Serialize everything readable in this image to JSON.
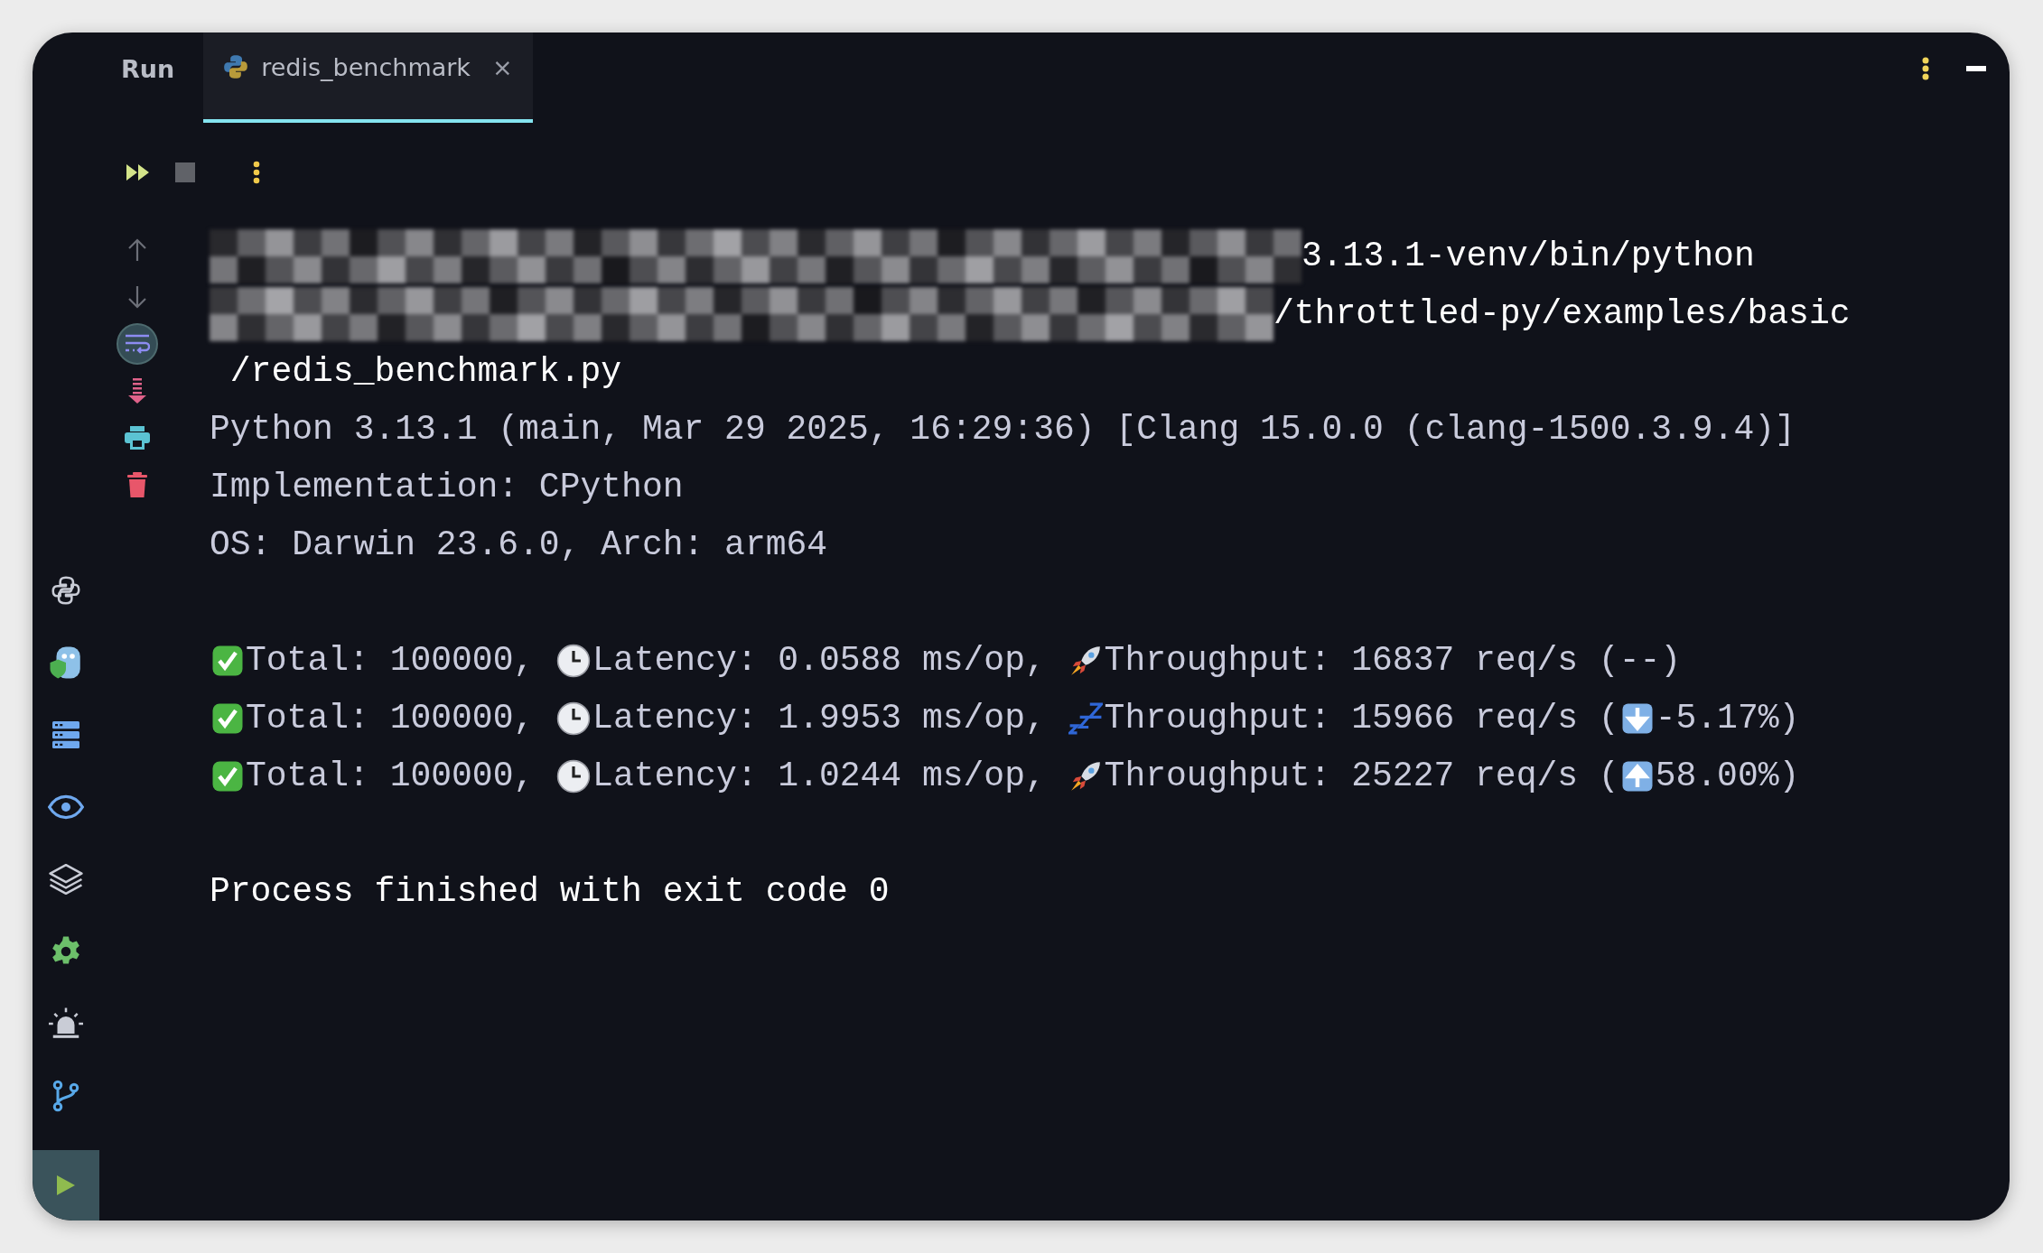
{
  "tool_window": {
    "title": "Run"
  },
  "tabs": [
    {
      "label": "redis_benchmark",
      "selected": true,
      "close": "×"
    }
  ],
  "sidebar": [
    {
      "kind": "python",
      "selected": false
    },
    {
      "kind": "gopher",
      "selected": false
    },
    {
      "kind": "database",
      "selected": false
    },
    {
      "kind": "eye",
      "selected": false
    },
    {
      "kind": "layers",
      "selected": false
    },
    {
      "kind": "gear",
      "selected": false
    },
    {
      "kind": "alarm",
      "selected": false
    },
    {
      "kind": "branch",
      "selected": false
    },
    {
      "kind": "run",
      "selected": true
    }
  ],
  "toolbar": [
    {
      "kind": "rerun"
    },
    {
      "kind": "stop"
    },
    {
      "kind": "more"
    }
  ],
  "console_tools": [
    {
      "kind": "up",
      "on": false
    },
    {
      "kind": "down",
      "on": false
    },
    {
      "kind": "wrap",
      "on": true
    },
    {
      "kind": "scroll-end",
      "on": false
    },
    {
      "kind": "print",
      "on": false
    },
    {
      "kind": "clear",
      "on": false
    }
  ],
  "command": [
    {
      "redacted": true,
      "text": "3.13.1-venv/bin/python"
    },
    {
      "redacted": true,
      "text": "/throttled-py/examples/basic"
    },
    {
      "redacted": false,
      "text": " /redis_benchmark.py"
    }
  ],
  "info": [
    "Python 3.13.1 (main, Mar 29 2025, 16:29:36) [Clang 15.0.0 (clang-1500.3.9.4)]",
    "Implementation: CPython",
    "OS: Darwin 23.6.0, Arch: arm64"
  ],
  "results": [
    {
      "total": "Total: 100000,",
      "latency": "Latency: 0.0588 ms/op,",
      "speed": {
        "kind": "rocket"
      },
      "throughput": "Throughput: 16837 req/s (",
      "change": "--)"
    },
    {
      "total": "Total: 100000,",
      "latency": "Latency: 1.9953 ms/op,",
      "speed": {
        "kind": "sleep"
      },
      "throughput": "Throughput: 15966 req/s (",
      "change_icon": {
        "kind": "down"
      },
      "change": "-5.17%)"
    },
    {
      "total": "Total: 100000,",
      "latency": "Latency: 1.0244 ms/op,",
      "speed": {
        "kind": "rocket"
      },
      "throughput": "Throughput: 25227 req/s (",
      "change_icon": {
        "kind": "up"
      },
      "change": "58.00%)"
    }
  ],
  "exit_message": "Process finished with exit code 0"
}
